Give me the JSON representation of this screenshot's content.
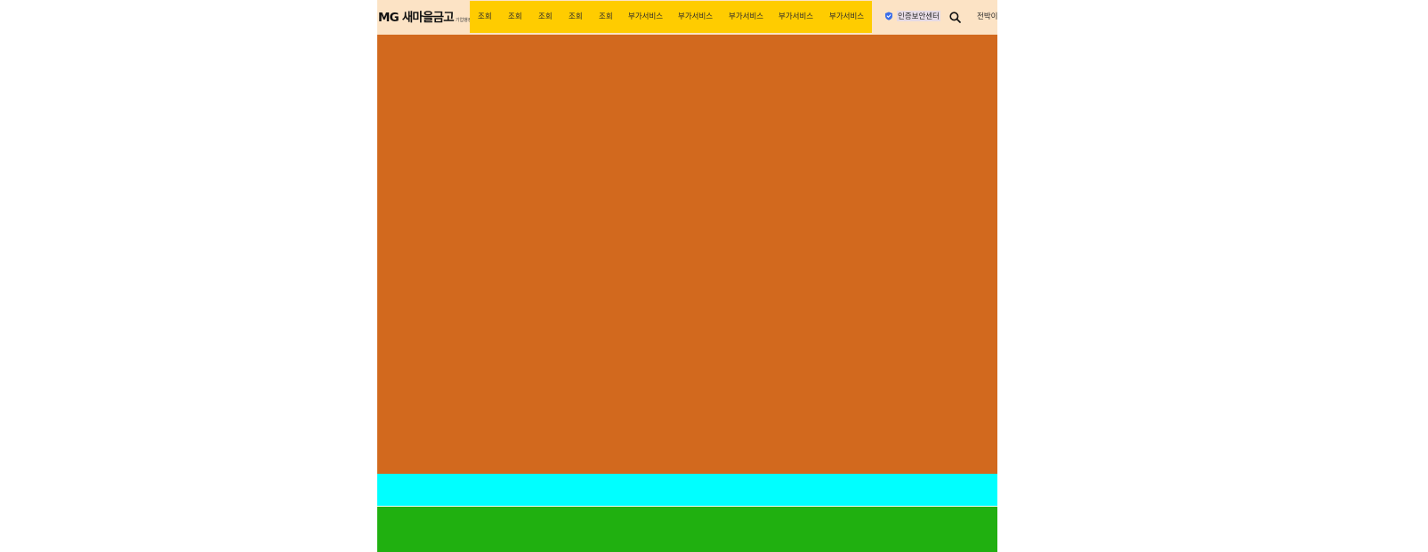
{
  "header": {
    "logo": {
      "main": "MG 새마을금고",
      "sub": "기업뱅킹"
    },
    "nav_items": [
      "조회",
      "조회",
      "조회",
      "조회",
      "조회",
      "부가서비스",
      "부가서비스",
      "부가서비스",
      "부가서비스",
      "부가서비스"
    ],
    "security_center": "인증보안센터",
    "misc_link": "전박이"
  },
  "colors": {
    "header_bg": "#fce3c5",
    "nav_bg": "#ffcc00",
    "hero_bg": "#d2691e",
    "band_cyan": "#00ffff",
    "band_green": "#20b010",
    "shield": "#3b6ee8"
  },
  "icons": {
    "security": "shield-check-icon",
    "search": "search-icon"
  }
}
